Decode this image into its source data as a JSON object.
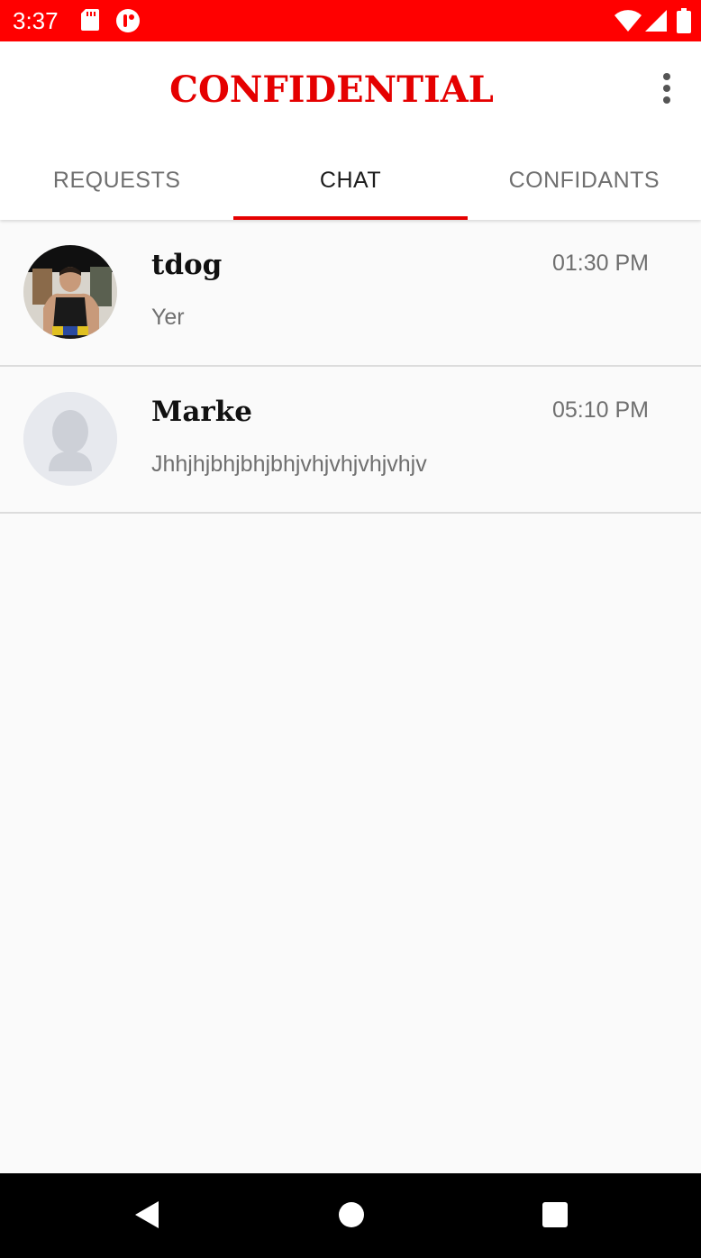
{
  "status_bar": {
    "time": "3:37",
    "icons": [
      "sd-card-icon",
      "app-notification-icon",
      "wifi-icon",
      "signal-icon",
      "battery-icon"
    ]
  },
  "app_bar": {
    "title": "CONFIDENTIAL",
    "menu_icon": "more-vert-icon"
  },
  "tabs": [
    {
      "label": "REQUESTS",
      "active": false
    },
    {
      "label": "CHAT",
      "active": true
    },
    {
      "label": "CONFIDANTS",
      "active": false
    }
  ],
  "chats": [
    {
      "name": "tdog",
      "time": "01:30 PM",
      "preview": "Yer",
      "avatar": "photo-avatar"
    },
    {
      "name": "Marke",
      "time": "05:10 PM",
      "preview": "Jhhjhjbhjbhjbhjvhjvhjvhjvhjv",
      "avatar": "default-avatar"
    }
  ],
  "nav_bar": {
    "buttons": [
      "back-icon",
      "home-icon",
      "recents-icon"
    ]
  },
  "colors": {
    "accent": "#e50000",
    "status_bar": "#ff0000",
    "background": "#fafafa"
  }
}
